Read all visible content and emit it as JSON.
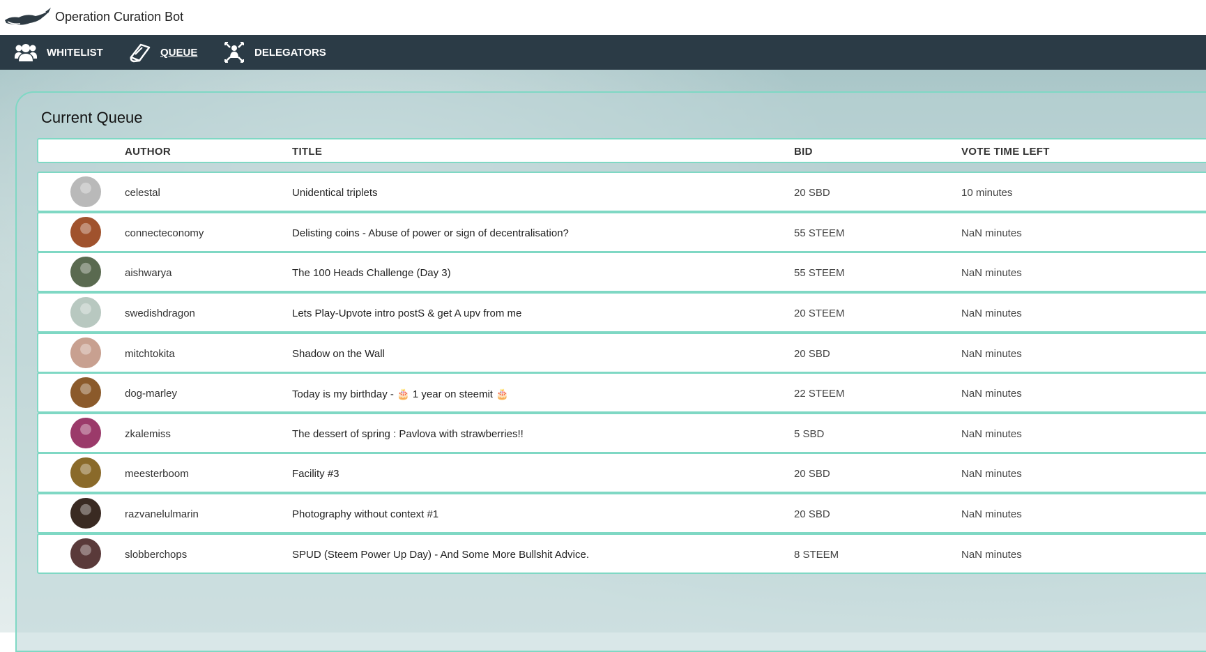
{
  "app": {
    "title": "Operation Curation Bot"
  },
  "nav": {
    "items": [
      {
        "label": "WHITELIST",
        "icon": "users-icon"
      },
      {
        "label": "QUEUE",
        "icon": "book-icon",
        "active": true
      },
      {
        "label": "DELEGATORS",
        "icon": "delegators-icon"
      }
    ]
  },
  "queue": {
    "heading": "Current Queue",
    "columns": [
      "AUTHOR",
      "TITLE",
      "BID",
      "VOTE TIME LEFT"
    ],
    "rows": [
      {
        "author": "celestal",
        "title": "Unidentical triplets",
        "bid": "20 SBD",
        "time_left": "10 minutes",
        "avatar_color": "#b9b9b9"
      },
      {
        "author": "connecteconomy",
        "title": "Delisting coins - Abuse of power or sign of decentralisation?",
        "bid": "55 STEEM",
        "time_left": "NaN minutes",
        "avatar_color": "#a0522d"
      },
      {
        "author": "aishwarya",
        "title": "The 100 Heads Challenge (Day 3)",
        "bid": "55 STEEM",
        "time_left": "NaN minutes",
        "avatar_color": "#5a6a50"
      },
      {
        "author": "swedishdragon",
        "title": "Lets Play-Upvote intro postS & get A upv from me",
        "bid": "20 STEEM",
        "time_left": "NaN minutes",
        "avatar_color": "#b8c8c0"
      },
      {
        "author": "mitchtokita",
        "title": "Shadow on the Wall",
        "bid": "20 SBD",
        "time_left": "NaN minutes",
        "avatar_color": "#c8a090"
      },
      {
        "author": "dog-marley",
        "title": "Today is my birthday - 🎂 1 year on steemit 🎂",
        "bid": "22 STEEM",
        "time_left": "NaN minutes",
        "avatar_color": "#8b5a2b"
      },
      {
        "author": "zkalemiss",
        "title": "The dessert of spring : Pavlova with strawberries!!",
        "bid": "5 SBD",
        "time_left": "NaN minutes",
        "avatar_color": "#9b3a6a"
      },
      {
        "author": "meesterboom",
        "title": "Facility #3",
        "bid": "20 SBD",
        "time_left": "NaN minutes",
        "avatar_color": "#8a6a2a"
      },
      {
        "author": "razvanelulmarin",
        "title": "Photography without context #1",
        "bid": "20 SBD",
        "time_left": "NaN minutes",
        "avatar_color": "#3a2a22"
      },
      {
        "author": "slobberchops",
        "title": "SPUD (Steem Power Up Day) - And Some More Bullshit Advice.",
        "bid": "8 STEEM",
        "time_left": "NaN minutes",
        "avatar_color": "#5a3a3a"
      }
    ]
  },
  "colors": {
    "navbar": "#2b3b46",
    "row_border": "#7fd8c4"
  }
}
